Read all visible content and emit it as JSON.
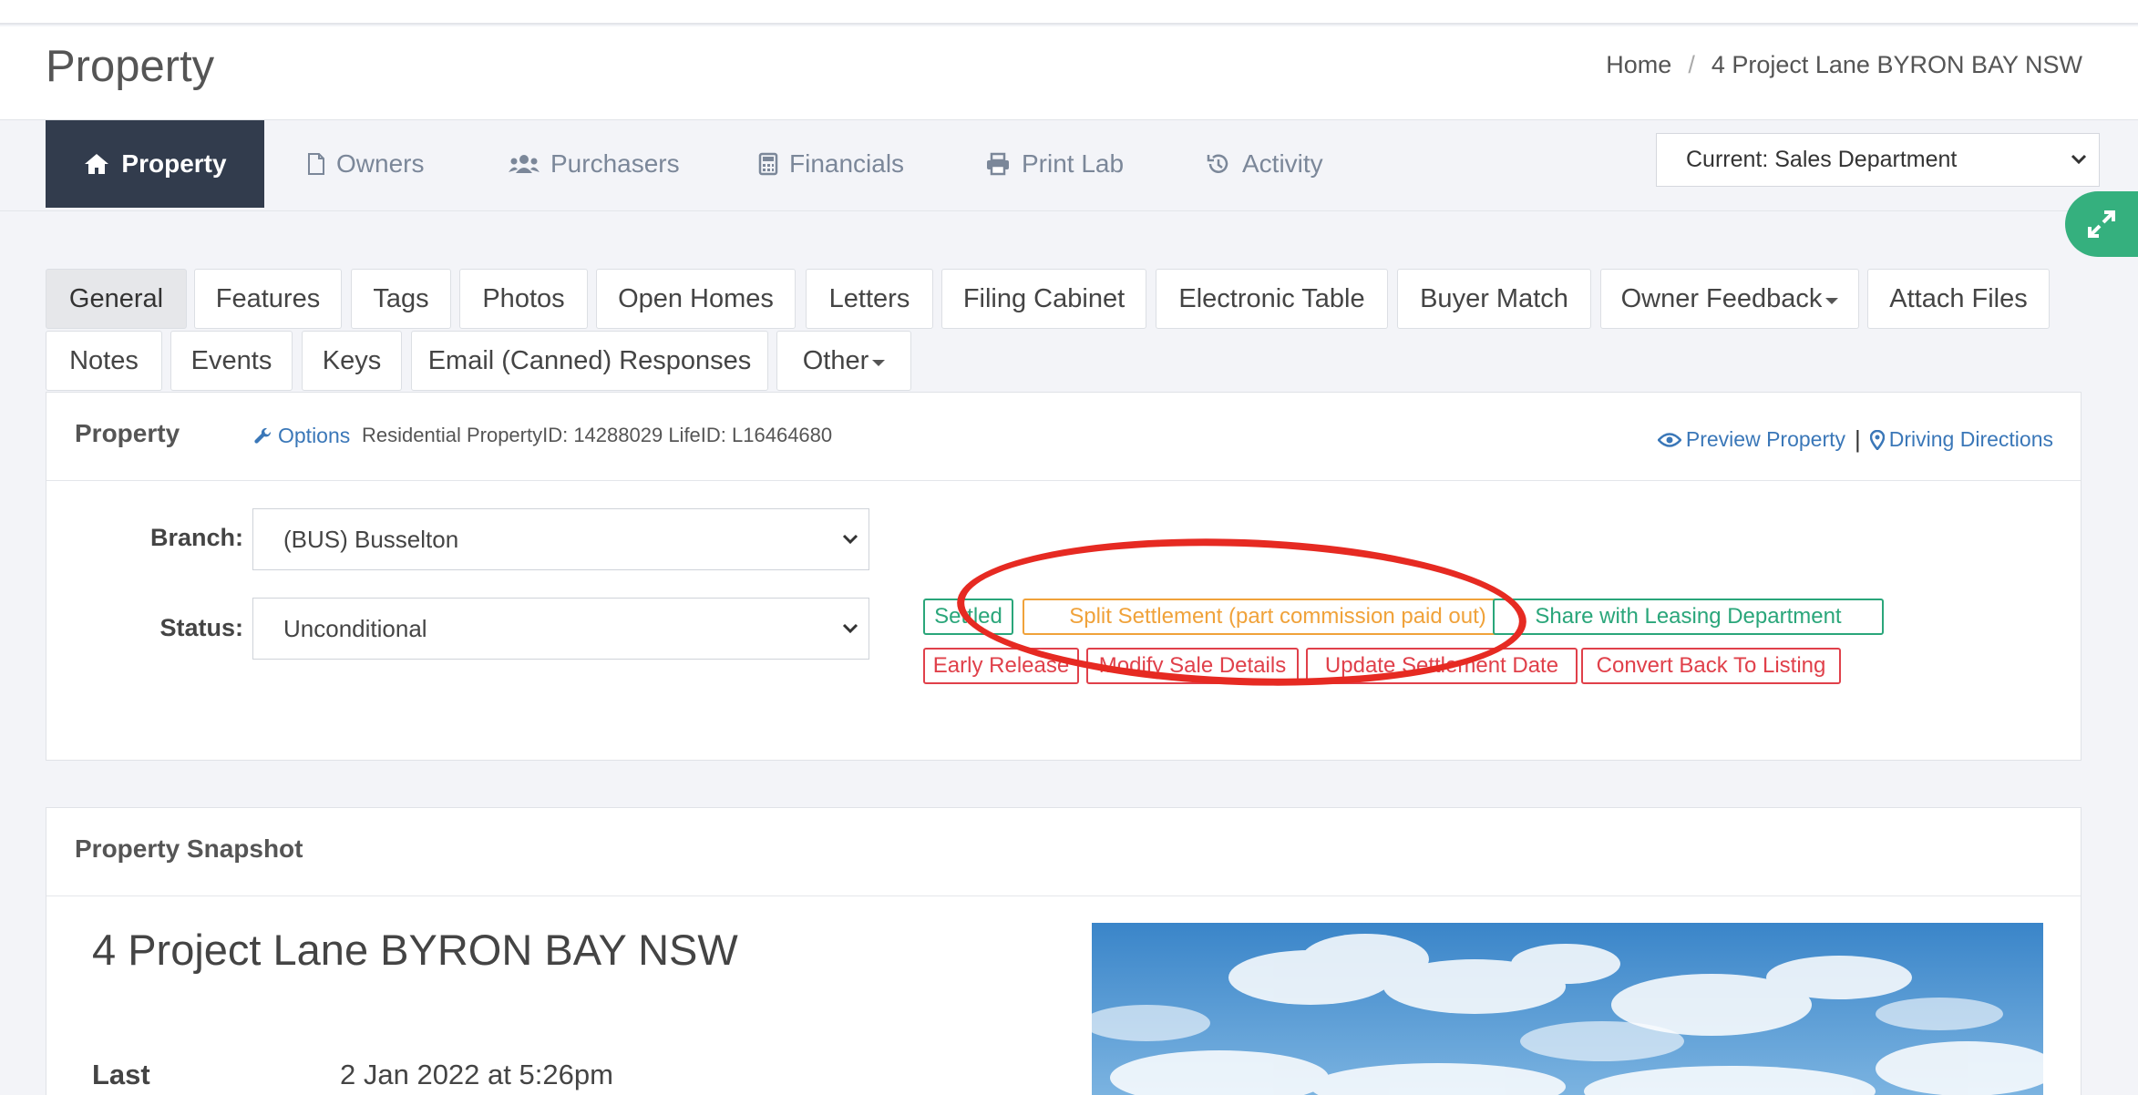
{
  "header": {
    "title": "Property",
    "breadcrumb": {
      "home": "Home",
      "separator": "/",
      "current": "4 Project Lane BYRON BAY NSW"
    }
  },
  "nav": {
    "items": [
      {
        "label": "Property",
        "icon": "home-icon"
      },
      {
        "label": "Owners",
        "icon": "file-icon"
      },
      {
        "label": "Purchasers",
        "icon": "users-icon"
      },
      {
        "label": "Financials",
        "icon": "calculator-icon"
      },
      {
        "label": "Print Lab",
        "icon": "printer-icon"
      },
      {
        "label": "Activity",
        "icon": "history-icon"
      }
    ],
    "department": "Current: Sales Department"
  },
  "subtabs": {
    "row1": [
      "General",
      "Features",
      "Tags",
      "Photos",
      "Open Homes",
      "Letters",
      "Filing Cabinet",
      "Electronic Table",
      "Buyer Match",
      "Owner Feedback",
      "Attach Files"
    ],
    "row2": [
      "Notes",
      "Events",
      "Keys",
      "Email (Canned) Responses",
      "Other"
    ]
  },
  "property_panel": {
    "title": "Property",
    "options": "Options",
    "meta": "Residential PropertyID: 14288029 LifeID: L16464680",
    "preview": "Preview Property",
    "separator": "|",
    "directions": "Driving Directions",
    "branch_label": "Branch:",
    "branch_value": "(BUS) Busselton",
    "status_label": "Status:",
    "status_value": "Unconditional",
    "actions_row1": [
      "Settled",
      "Split Settlement (part commission paid out)",
      "Share with Leasing Department"
    ],
    "actions_row2": [
      "Early Release",
      "Modify Sale Details",
      "Update Settlement Date",
      "Convert Back To Listing"
    ]
  },
  "snapshot": {
    "title": "Property Snapshot",
    "address": "4 Project Lane BYRON BAY NSW",
    "last_label": "Last",
    "last_value": "2 Jan 2022 at 5:26pm"
  },
  "colors": {
    "nav_active": "#323c4d",
    "link": "#3a77b8",
    "green": "#2aa67a",
    "orange": "#f0a23a",
    "red": "#e0404a",
    "annotation": "#e62a22",
    "expand": "#35b07e"
  }
}
